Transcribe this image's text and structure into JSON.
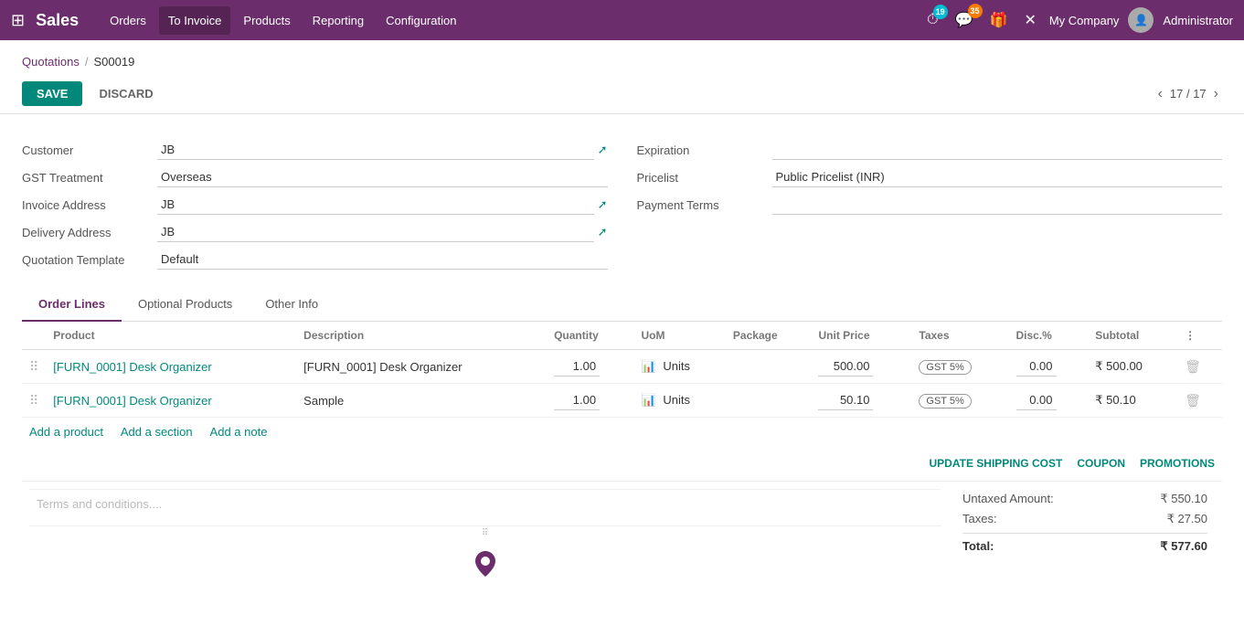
{
  "app": {
    "name": "Sales",
    "grid_icon": "⊞"
  },
  "topnav": {
    "menus": [
      {
        "label": "Orders",
        "active": false
      },
      {
        "label": "To Invoice",
        "active": true
      },
      {
        "label": "Products",
        "active": false
      },
      {
        "label": "Reporting",
        "active": false
      },
      {
        "label": "Configuration",
        "active": false
      }
    ],
    "clock_badge": "19",
    "chat_badge": "35",
    "company": "My Company",
    "user": "Administrator"
  },
  "breadcrumb": {
    "parent": "Quotations",
    "separator": "/",
    "current": "S00019"
  },
  "toolbar": {
    "save_label": "SAVE",
    "discard_label": "DISCARD",
    "pagination": "17 / 17"
  },
  "form": {
    "left": {
      "customer_label": "Customer",
      "customer_value": "JB",
      "gst_treatment_label": "GST Treatment",
      "gst_treatment_value": "Overseas",
      "invoice_address_label": "Invoice Address",
      "invoice_address_value": "JB",
      "delivery_address_label": "Delivery Address",
      "delivery_address_value": "JB",
      "quotation_template_label": "Quotation Template",
      "quotation_template_value": "Default"
    },
    "right": {
      "expiration_label": "Expiration",
      "expiration_value": "",
      "pricelist_label": "Pricelist",
      "pricelist_value": "Public Pricelist (INR)",
      "payment_terms_label": "Payment Terms",
      "payment_terms_value": ""
    }
  },
  "tabs": [
    {
      "label": "Order Lines",
      "active": true
    },
    {
      "label": "Optional Products",
      "active": false
    },
    {
      "label": "Other Info",
      "active": false
    }
  ],
  "table": {
    "columns": [
      {
        "label": "",
        "key": "drag"
      },
      {
        "label": "Product"
      },
      {
        "label": "Description"
      },
      {
        "label": "Quantity"
      },
      {
        "label": "UoM"
      },
      {
        "label": "Package"
      },
      {
        "label": "Unit Price"
      },
      {
        "label": "Taxes"
      },
      {
        "label": "Disc.%"
      },
      {
        "label": "Subtotal"
      },
      {
        "label": ""
      }
    ],
    "rows": [
      {
        "id": 1,
        "product": "[FURN_0001] Desk Organizer",
        "description": "[FURN_0001] Desk Organizer",
        "quantity": "1.00",
        "uom": "Units",
        "package": "",
        "unit_price": "500.00",
        "taxes": "GST 5%",
        "disc": "0.00",
        "subtotal": "₹ 500.00"
      },
      {
        "id": 2,
        "product": "[FURN_0001] Desk Organizer",
        "description": "Sample",
        "quantity": "1.00",
        "uom": "Units",
        "package": "",
        "unit_price": "50.10",
        "taxes": "GST 5%",
        "disc": "0.00",
        "subtotal": "₹ 50.10"
      }
    ],
    "add_product": "Add a product",
    "add_section": "Add a section",
    "add_note": "Add a note"
  },
  "bottom_actions": {
    "update_shipping": "UPDATE SHIPPING COST",
    "coupon": "COUPON",
    "promotions": "PROMOTIONS"
  },
  "terms_placeholder": "Terms and conditions....",
  "totals": {
    "untaxed_label": "Untaxed Amount:",
    "untaxed_value": "₹ 550.10",
    "taxes_label": "Taxes:",
    "taxes_value": "₹ 27.50",
    "total_label": "Total:",
    "total_value": "₹ 577.60"
  }
}
